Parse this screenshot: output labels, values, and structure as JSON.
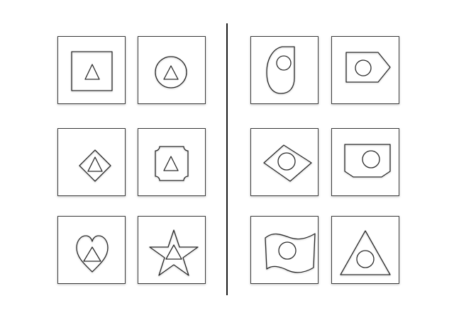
{
  "colors": {
    "stroke": "#2a2a2a",
    "background": "#ffffff",
    "divider": "#1a1a1a"
  },
  "left_group": [
    {
      "outer": "square-icon",
      "inner": "triangle-icon"
    },
    {
      "outer": "circle-icon",
      "inner": "triangle-icon"
    },
    {
      "outer": "diamond-icon",
      "inner": "triangle-icon"
    },
    {
      "outer": "notched-square-icon",
      "inner": "triangle-icon"
    },
    {
      "outer": "heart-icon",
      "inner": "triangle-icon"
    },
    {
      "outer": "star-icon",
      "inner": "triangle-icon"
    }
  ],
  "right_group": [
    {
      "outer": "rounded-blob-icon",
      "inner": "circle-icon"
    },
    {
      "outer": "pentagon-arrow-icon",
      "inner": "circle-icon"
    },
    {
      "outer": "rhombus-icon",
      "inner": "circle-icon"
    },
    {
      "outer": "shield-banner-icon",
      "inner": "circle-icon"
    },
    {
      "outer": "wavy-flag-icon",
      "inner": "circle-icon"
    },
    {
      "outer": "triangle-icon",
      "inner": "circle-icon"
    }
  ]
}
